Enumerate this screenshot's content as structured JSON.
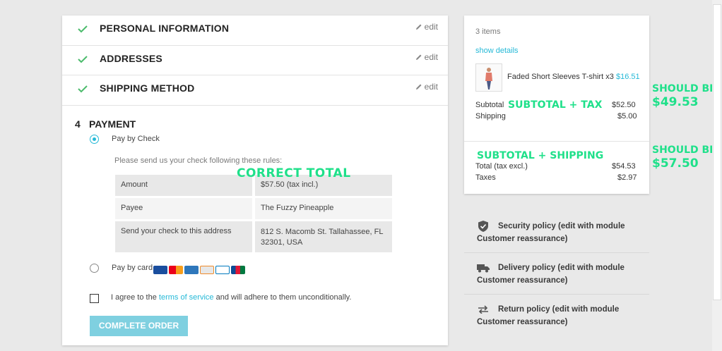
{
  "steps": [
    {
      "title": "PERSONAL INFORMATION",
      "edit": "edit"
    },
    {
      "title": "ADDRESSES",
      "edit": "edit"
    },
    {
      "title": "SHIPPING METHOD",
      "edit": "edit"
    }
  ],
  "payment": {
    "number": "4",
    "title": "PAYMENT",
    "check_label": "Pay by Check",
    "rules_text": "Please send us your check following these rules:",
    "rows": [
      {
        "label": "Amount",
        "value": "$57.50 (tax incl.)"
      },
      {
        "label": "Payee",
        "value": "The Fuzzy Pineapple"
      },
      {
        "label": "Send your check to this address",
        "value": "812 S. Macomb St. Tallahassee, FL 32301, USA"
      }
    ],
    "card_label": "Pay by card",
    "terms_prefix": "I agree to the ",
    "terms_link": "terms of service",
    "terms_suffix": " and will adhere to them unconditionally.",
    "complete_button": "COMPLETE ORDER"
  },
  "summary": {
    "items_count": "3 items",
    "show_details": "show details",
    "product_name": "Faded Short Sleeves T-shirt x3",
    "product_price": "$16.51",
    "subtotal_label": "Subtotal",
    "subtotal_value": "$52.50",
    "shipping_label": "Shipping",
    "shipping_value": "$5.00",
    "total_label": "Total (tax excl.)",
    "total_value": "$54.53",
    "taxes_label": "Taxes",
    "taxes_value": "$2.97"
  },
  "reassurance": [
    {
      "text": "Security policy (edit with module Customer reassurance)",
      "icon": "shield-icon"
    },
    {
      "text": "Delivery policy (edit with module Customer reassurance)",
      "icon": "truck-icon"
    },
    {
      "text": "Return policy (edit with module Customer reassurance)",
      "icon": "return-arrows-icon"
    }
  ],
  "annotations": {
    "correct_total": "CORRECT TOTAL",
    "subtotal_tax": "SUBTOTAL + TAX",
    "subtotal_shipping": "SUBTOTAL + SHIPPING",
    "should_be_1_line1": "SHOULD BE",
    "should_be_1_line2": "$49.53",
    "should_be_2_line1": "SHOULD BE",
    "should_be_2_line2": "$57.50"
  },
  "colors": {
    "accent": "#25b9d7",
    "check_green": "#4cbb6c",
    "annotation_green": "#1fe08a",
    "button_bg": "#7fd0e0"
  }
}
